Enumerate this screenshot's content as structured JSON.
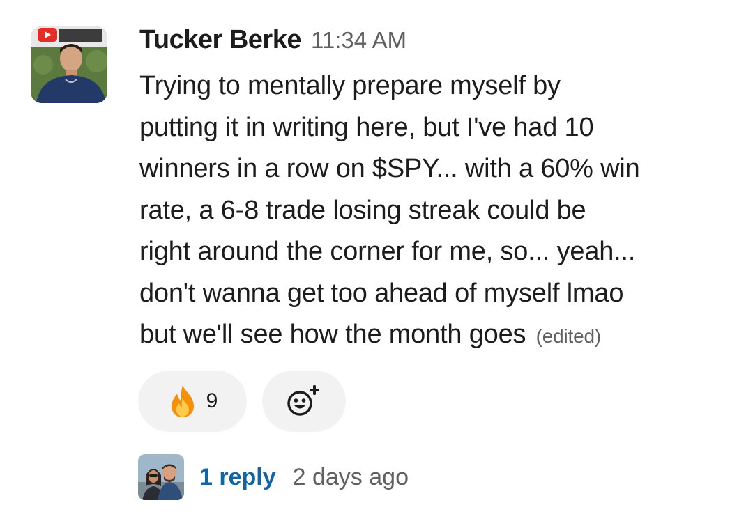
{
  "message": {
    "author": "Tucker Berke",
    "timestamp": "11:34 AM",
    "lines": [
      "Trying to mentally prepare myself by",
      "putting it in writing here, but I've had 10",
      "winners in a row on $SPY... with a 60% win",
      "rate, a 6-8 trade losing streak could be",
      "right around the corner for me, so... yeah...",
      "don't wanna get too ahead of myself lmao",
      "but we'll see how the month goes"
    ],
    "edited_label": "(edited)"
  },
  "reactions": {
    "fire": {
      "icon": "fire-icon",
      "count": "9"
    },
    "add_reaction": {
      "icon": "add-reaction-icon"
    }
  },
  "thread": {
    "reply_count": "1 reply",
    "last_reply": "2 days ago"
  },
  "colors": {
    "text": "#1d1c1d",
    "muted": "#616061",
    "link": "#1264a3",
    "pill_bg": "#f2f2f2"
  }
}
